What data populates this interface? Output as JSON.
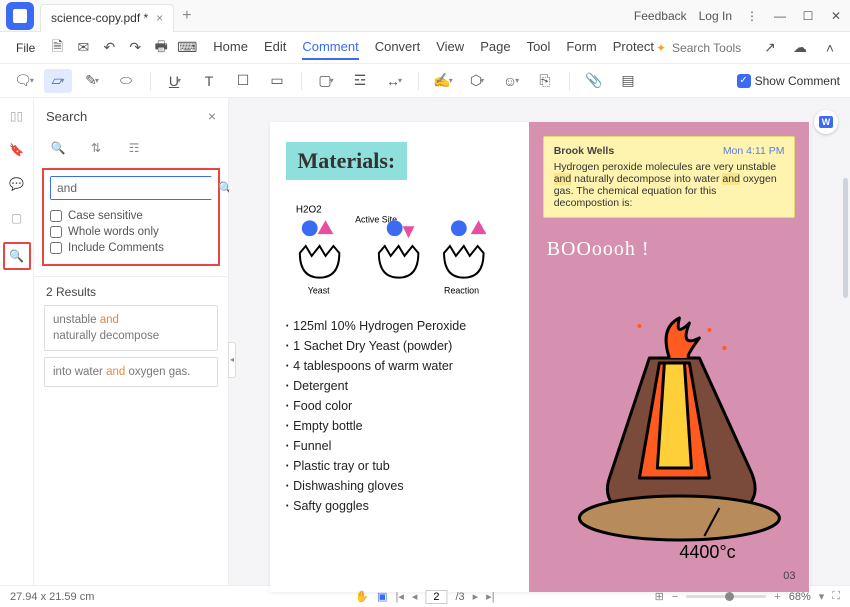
{
  "titlebar": {
    "filename": "science-copy.pdf *",
    "feedback": "Feedback",
    "login": "Log In"
  },
  "menubar": {
    "file": "File",
    "tabs": [
      "Home",
      "Edit",
      "Comment",
      "Convert",
      "View",
      "Page",
      "Tool",
      "Form",
      "Protect"
    ],
    "active": "Comment",
    "search_placeholder": "Search Tools"
  },
  "toolbar2": {
    "show_comment": "Show Comment"
  },
  "searchpanel": {
    "title": "Search",
    "query": "and",
    "opt1": "Case sensitive",
    "opt2": "Whole words only",
    "opt3": "Include Comments",
    "results_label": "2 Results",
    "results": [
      {
        "pre": "unstable ",
        "hl": "and",
        "post": "\nnaturally decompose"
      },
      {
        "pre": "into water ",
        "hl": "and",
        "post": " oxygen gas."
      }
    ]
  },
  "document": {
    "materials_heading": "Materials:",
    "sketch_labels": {
      "h2o2": "H2O2",
      "active": "Active Site",
      "yeast": "Yeast",
      "reaction": "Reaction"
    },
    "materials": [
      "125ml 10% Hydrogen Peroxide",
      "1 Sachet Dry Yeast (powder)",
      "4 tablespoons of warm water",
      "Detergent",
      "Food color",
      "Empty bottle",
      "Funnel",
      "Plastic tray or tub",
      "Dishwashing gloves",
      "Safty goggles"
    ],
    "note": {
      "author": "Brook Wells",
      "time": "Mon 4:11 PM",
      "body_pre": "Hydrogen peroxide molecules are very unstable ",
      "hl1": "and",
      "body_mid": " naturally decompose into water ",
      "hl2": "and",
      "body_post": " oxygen gas. The chemical equation for this decompostion is:"
    },
    "boom": "BOOoooh !",
    "temp": "4400°c",
    "page_num": "03",
    "word_badge": "W"
  },
  "statusbar": {
    "dims": "27.94 x 21.59 cm",
    "page": "2",
    "total": "/3",
    "zoom": "68%"
  }
}
